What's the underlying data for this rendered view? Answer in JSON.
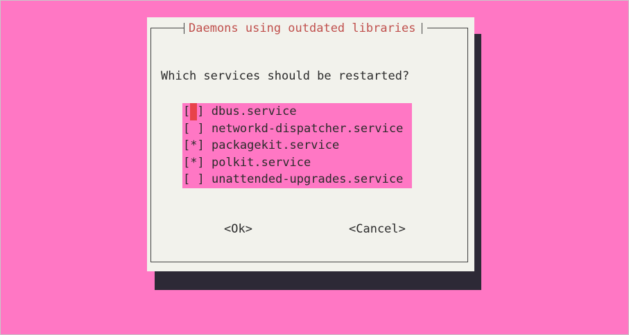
{
  "dialog": {
    "title": "Daemons using outdated libraries",
    "question": "Which services should be restarted?",
    "services": [
      {
        "mark": "[ ]",
        "name": "dbus.service",
        "checked": false,
        "focused": true
      },
      {
        "mark": "[ ]",
        "name": "networkd-dispatcher.service",
        "checked": false,
        "focused": false
      },
      {
        "mark": "[*]",
        "name": "packagekit.service",
        "checked": true,
        "focused": false
      },
      {
        "mark": "[*]",
        "name": "polkit.service",
        "checked": true,
        "focused": false
      },
      {
        "mark": "[ ]",
        "name": "unattended-upgrades.service",
        "checked": false,
        "focused": false
      }
    ],
    "ok_label": "<Ok>",
    "cancel_label": "<Cancel>"
  },
  "colors": {
    "background": "#ff77c4",
    "dialog": "#f2f2ec",
    "shadow": "#2d2936",
    "title_text": "#c0504d",
    "cursor": "#e8434a"
  }
}
